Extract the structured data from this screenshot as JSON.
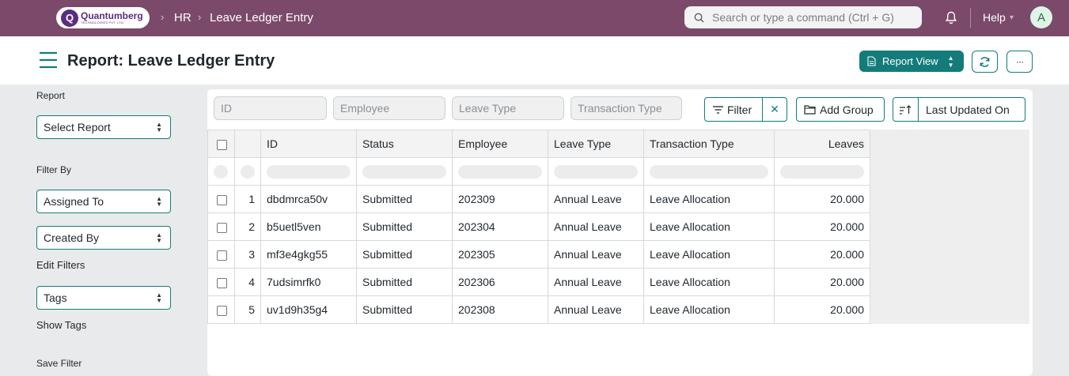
{
  "navbar": {
    "logo_mark": "Q",
    "logo_name": "Quantumberg",
    "logo_sub": "TECHNOLOGIES PVT. LTD.",
    "breadcrumbs": [
      "HR",
      "Leave Ledger Entry"
    ],
    "search_placeholder": "Search or type a command (Ctrl + G)",
    "help_label": "Help",
    "avatar_initial": "A"
  },
  "pagehead": {
    "title": "Report: Leave Ledger Entry",
    "view_button_label": "Report View",
    "more_label": "···"
  },
  "sidebar": {
    "report_label": "Report",
    "report_select": "Select Report",
    "filter_by_label": "Filter By",
    "assigned_to": "Assigned To",
    "created_by": "Created By",
    "edit_filters": "Edit Filters",
    "tags": "Tags",
    "show_tags": "Show Tags",
    "save_filter": "Save Filter"
  },
  "filters": {
    "id_placeholder": "ID",
    "employee_placeholder": "Employee",
    "leave_type_placeholder": "Leave Type",
    "transaction_type_placeholder": "Transaction Type",
    "filter_label": "Filter",
    "clear_label": "✕",
    "add_group_label": "Add Group",
    "sort_label": "Last Updated On"
  },
  "table": {
    "columns": [
      "ID",
      "Status",
      "Employee",
      "Leave Type",
      "Transaction Type",
      "Leaves"
    ],
    "rows": [
      {
        "n": "1",
        "id": "dbdmrca50v",
        "status": "Submitted",
        "employee": "202309",
        "leave_type": "Annual Leave",
        "transaction_type": "Leave Allocation",
        "leaves": "20.000"
      },
      {
        "n": "2",
        "id": "b5uetl5ven",
        "status": "Submitted",
        "employee": "202304",
        "leave_type": "Annual Leave",
        "transaction_type": "Leave Allocation",
        "leaves": "20.000"
      },
      {
        "n": "3",
        "id": "mf3e4gkg55",
        "status": "Submitted",
        "employee": "202305",
        "leave_type": "Annual Leave",
        "transaction_type": "Leave Allocation",
        "leaves": "20.000"
      },
      {
        "n": "4",
        "id": "7udsimrfk0",
        "status": "Submitted",
        "employee": "202306",
        "leave_type": "Annual Leave",
        "transaction_type": "Leave Allocation",
        "leaves": "20.000"
      },
      {
        "n": "5",
        "id": "uv1d9h35g4",
        "status": "Submitted",
        "employee": "202308",
        "leave_type": "Annual Leave",
        "transaction_type": "Leave Allocation",
        "leaves": "20.000"
      }
    ]
  },
  "colors": {
    "navbar": "#7b4a6a",
    "primary": "#137c7b"
  }
}
